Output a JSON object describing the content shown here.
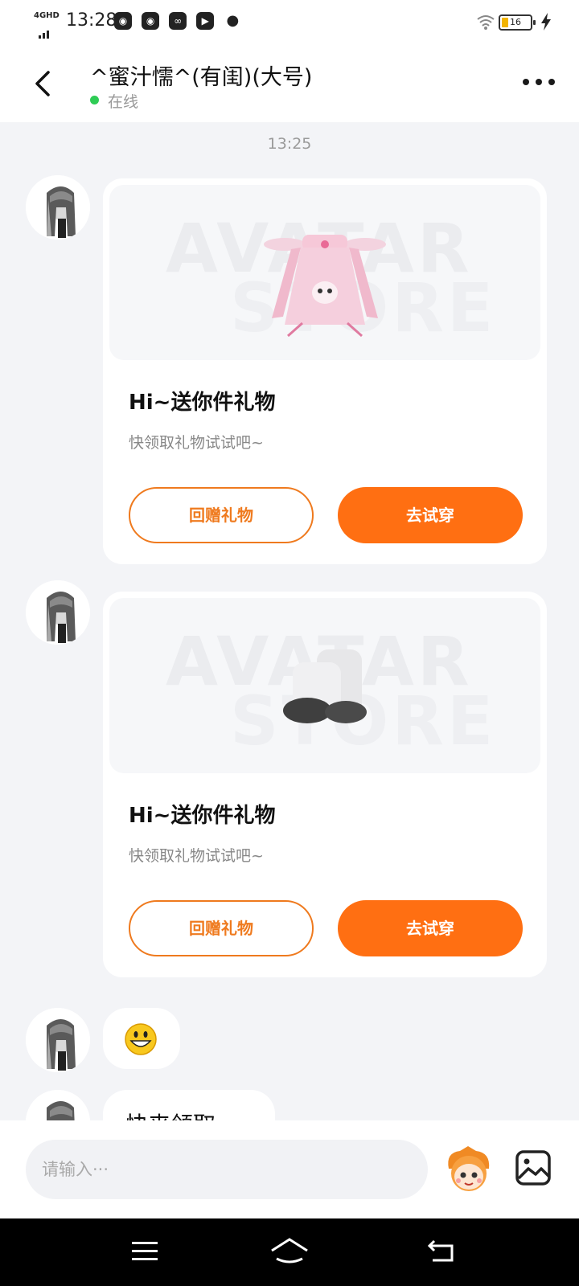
{
  "status_bar": {
    "network": "4GHD",
    "time": "13:28",
    "app_icons": [
      "qq-icon",
      "qq-icon",
      "link-icon",
      "video-icon",
      "wechat-icon"
    ],
    "battery_level": "16"
  },
  "header": {
    "title": "^蜜汁懦^(有闺)(大号)",
    "status": "在线"
  },
  "chat": {
    "timestamp": "13:25",
    "gift_cards": [
      {
        "item": "pink-bunny-dress",
        "watermark_top": "AVATAR",
        "watermark_bottom": "STORE",
        "title": "Hi~送你件礼物",
        "subtitle": "快领取礼物试试吧~",
        "return_label": "回赠礼物",
        "try_label": "去试穿"
      },
      {
        "item": "white-fluffy-boots",
        "watermark_top": "AVATAR",
        "watermark_bottom": "STORE",
        "title": "Hi~送你件礼物",
        "subtitle": "快领取礼物试试吧~",
        "return_label": "回赠礼物",
        "try_label": "去试穿"
      }
    ],
    "emoji_message": "grinning-face",
    "text_message": "快来领取"
  },
  "input_bar": {
    "placeholder": "请输入···"
  },
  "colors": {
    "accent": "#ff6f12",
    "online": "#2ecc55",
    "background": "#f3f4f7"
  }
}
